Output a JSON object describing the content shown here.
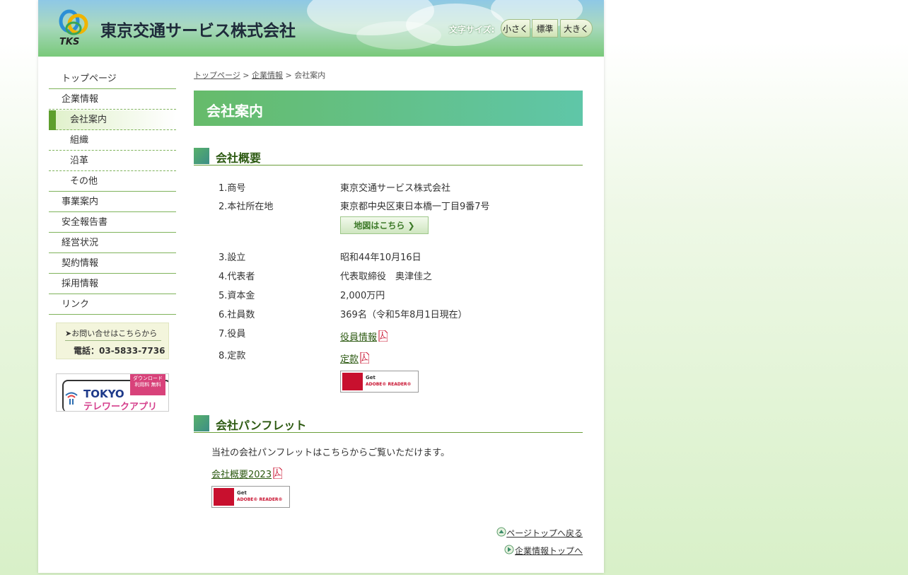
{
  "header": {
    "company_name": "東京交通サービス株式会社",
    "logo_text": "TKS",
    "fontsize_label": "文字サイズ:",
    "fontsize_small": "小さく",
    "fontsize_standard": "標準",
    "fontsize_large": "大きく"
  },
  "nav": {
    "items": [
      {
        "label": "トップページ"
      },
      {
        "label": "企業情報"
      },
      {
        "label": "会社案内"
      },
      {
        "label": "組織"
      },
      {
        "label": "沿革"
      },
      {
        "label": "その他"
      },
      {
        "label": "事業案内"
      },
      {
        "label": "安全報告書"
      },
      {
        "label": "経営状況"
      },
      {
        "label": "契約情報"
      },
      {
        "label": "採用情報"
      },
      {
        "label": "リンク"
      }
    ],
    "contact_line1": "➤お問い合せはこちらから",
    "contact_line2": "電話：03-5833-7736",
    "app_banner": {
      "badge": "ダウンロード 利用料 無料",
      "title1": "TOKYO",
      "title2": "テレワークアプリ"
    }
  },
  "breadcrumb": {
    "home": "トップページ",
    "sep1": " > ",
    "parent": "企業情報",
    "sep2": " > ",
    "current": "会社案内"
  },
  "page_title": "会社案内",
  "overview": {
    "heading": "会社概要",
    "rows": [
      {
        "label": "1.商号",
        "value": "東京交通サービス株式会社"
      },
      {
        "label": "2.本社所在地",
        "value": "東京都中央区東日本橋一丁目9番7号"
      },
      {
        "label": "3.設立",
        "value": "昭和44年10月16日"
      },
      {
        "label": "4.代表者",
        "value": "代表取締役　奥津佳之"
      },
      {
        "label": "5.資本金",
        "value": "2,000万円"
      },
      {
        "label": "6.社員数",
        "value": "369名（令和5年8月1日現在）"
      },
      {
        "label": "7.役員",
        "value": "役員情報"
      },
      {
        "label": "8.定款",
        "value": "定款"
      }
    ],
    "map_button": "地図はこちら ❯"
  },
  "adobe": {
    "get": "Get",
    "reader": "ADOBE® READER®"
  },
  "pamphlet": {
    "heading": "会社パンフレット",
    "text": "当社の会社パンフレットはこちらからご覧いただけます。",
    "link": "会社概要2023"
  },
  "footer": {
    "page_top": "ページトップへ戻る",
    "section_top": "企業情報トップへ"
  },
  "colors": {
    "accent_green": "#5e9e2e",
    "title_gradient_start": "#66bb6a",
    "title_gradient_end": "#5fc6a8",
    "heading_text": "#2d5a12"
  }
}
